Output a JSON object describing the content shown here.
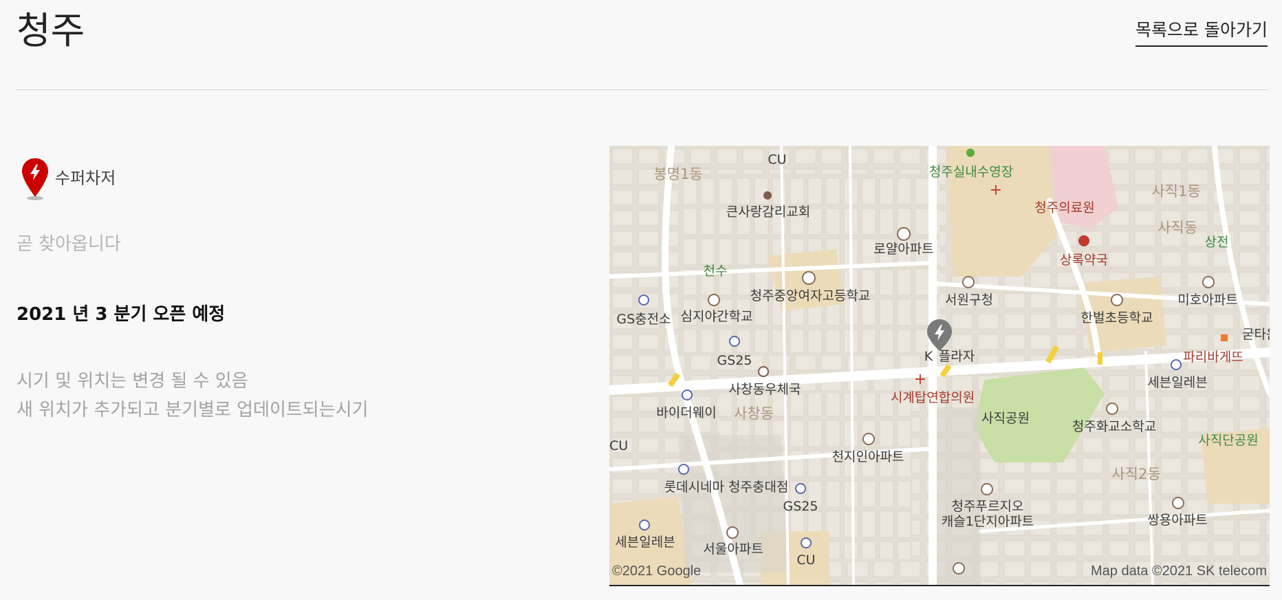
{
  "header": {
    "title": "청주",
    "back_label": "목록으로 돌아가기"
  },
  "charger": {
    "type_label": "수퍼차저",
    "status": "곧 찾아옵니다",
    "open_date": "2021 년 3 분기 오픈 예정",
    "notes": [
      "시기 및 위치는 변경 될 수 있음",
      "새 위치가 추가되고 분기별로 업데이트되는시기"
    ]
  },
  "colors": {
    "pin_red": "#cc0000",
    "map_bg": "#efebe4",
    "park": "#c8dfa5",
    "campus": "#ebdbb9"
  },
  "map": {
    "attribution_left": "©2021 Google",
    "attribution_right": "Map data ©2021 SK telecom",
    "labels": {
      "cu_top": "CU",
      "bongmyeong": "봉명1동",
      "pool": "청주실내수영장",
      "hospital": "청주의료원",
      "sajik1": "사직1동",
      "church": "큰사랑감리교회",
      "royal_apt": "로얄아파트",
      "pharmacy": "상록약국",
      "sajik_dong": "사직동",
      "sangjeon": "상전",
      "cheonsu": "천수",
      "girls_hs": "청주중앙여자고등학교",
      "seowon_office": "서원구청",
      "miho_apt": "미호아파트",
      "gs_station": "GS충전소",
      "night_school": "심지야간학교",
      "hanbeol_school": "한벌초등학교",
      "gs25_left": "GS25",
      "k_plaza": "K",
      "k_plaza_rest": "플라자",
      "paris": "파리바게뜨",
      "guteu": "굳타운",
      "post_office": "사창동우체국",
      "clinic": "시계탑연합의원",
      "seven_right": "세븐일레븐",
      "buyway": "바이더웨이",
      "sachang": "사창동",
      "sajik_park": "사직공원",
      "hwagok_school": "청주화교소학교",
      "sajikdan": "사직단공원",
      "cu_left": "CU",
      "cheonji_apt": "천지인아파트",
      "sajik2": "사직2동",
      "lotte_cinema": "롯데시네마 청주충대점",
      "gs25_bottom": "GS25",
      "prugio1": "청주푸르지오",
      "prugio2": "캐슬1단지아파트",
      "ssangyong": "쌍용아파트",
      "seven_left": "세븐일레븐",
      "seoul_apt": "서울아파트",
      "cu_bottom": "CU"
    }
  }
}
